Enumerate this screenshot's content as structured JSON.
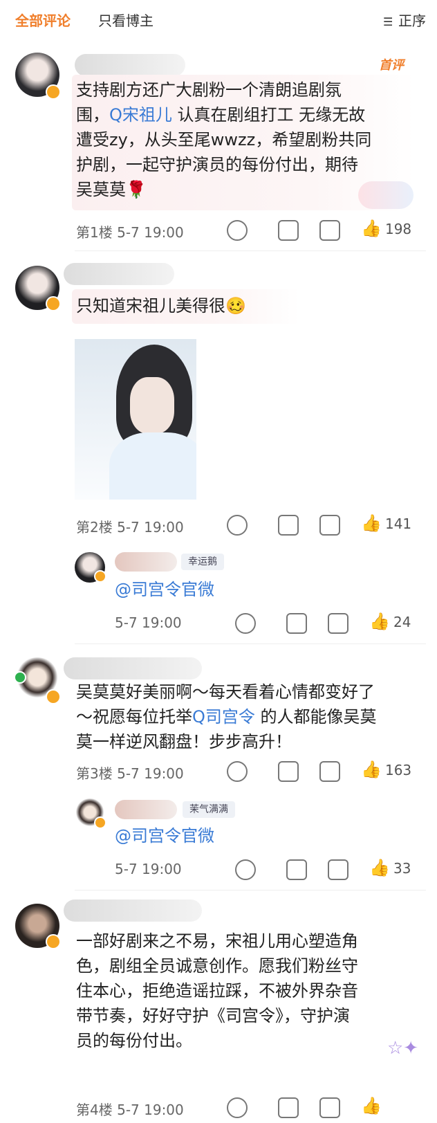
{
  "tabs": {
    "all": "全部评论",
    "author_only": "只看博主",
    "sort": "正序"
  },
  "icons": {
    "sort": "sort-icon",
    "dislike": "dislike-icon",
    "share": "share-icon",
    "comment": "comment-icon",
    "like": "like-icon"
  },
  "colors": {
    "accent": "#f07f2c",
    "link": "#3a7bd5"
  },
  "comments": [
    {
      "first_badge": "首评",
      "text_a": "支持剧方还广大剧粉一个清朗追剧氛",
      "text_b_pre": "围，",
      "text_b_link": "Q宋祖儿",
      "text_b_post": " 认真在剧组打工 无缘无故",
      "text_c": "遭受zy，从头至尾wwzz，希望剧粉共同",
      "text_d": "护剧，一起守护演员的每份付出，期待",
      "text_e": "吴莫莫🌹",
      "floor": "第1楼",
      "time": "5-7 19:00",
      "likes": "198"
    },
    {
      "text_a": "只知道宋祖儿美得很🥴",
      "floor": "第2楼",
      "time": "5-7 19:00",
      "likes": "141",
      "reply": {
        "tag": "幸运鹅",
        "text": "@司宫令官微",
        "time": "5-7 19:00",
        "likes": "24"
      }
    },
    {
      "text_a": "吴莫莫好美丽啊～每天看着心情都变好了",
      "text_b_pre": "～祝愿每位托举",
      "text_b_link": "Q司宫令",
      "text_b_post": " 的人都能像吴莫",
      "text_c": "莫一样逆风翻盘！步步高升！",
      "floor": "第3楼",
      "time": "5-7 19:00",
      "likes": "163",
      "reply": {
        "tag": "茉气满满",
        "text": "@司宫令官微",
        "time": "5-7 19:00",
        "likes": "33"
      }
    },
    {
      "text_a": "一部好剧来之不易，宋祖儿用心塑造角",
      "text_b": "色，剧组全员诚意创作。愿我们粉丝守",
      "text_c": "住本心，拒绝造谣拉踩，不被外界杂音",
      "text_d": "带节奏，好好守护《司宫令》，守护演",
      "text_e": "员的每份付出。",
      "floor": "第4楼",
      "time": "5-7 19:00"
    }
  ]
}
